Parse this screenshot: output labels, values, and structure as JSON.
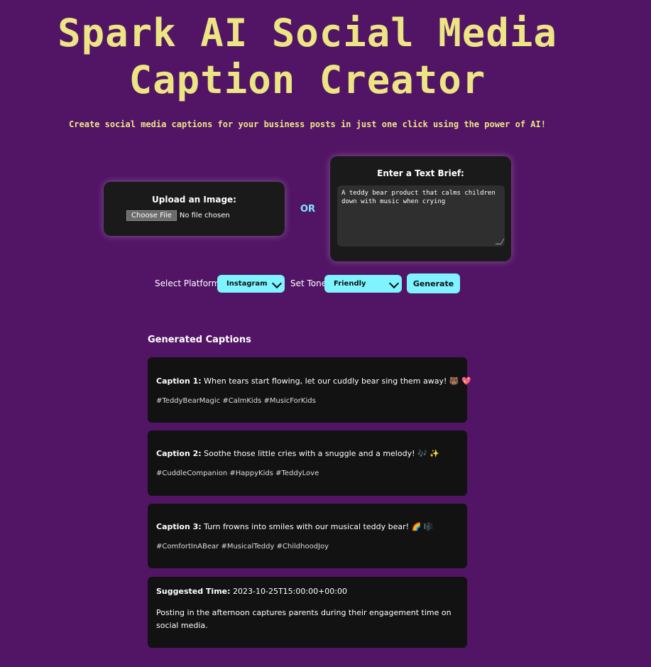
{
  "header": {
    "title_line1": "Spark AI Social Media",
    "title_line2": "Caption Creator",
    "subtitle": "Create social media captions for your business posts in just one click using the power of AI!"
  },
  "upload": {
    "label": "Upload an Image:",
    "button_label": "Choose File",
    "status": "No file chosen"
  },
  "separator": "OR",
  "brief": {
    "label": "Enter a Text Brief:",
    "value": "A teddy bear product that calms children down with music when crying"
  },
  "controls": {
    "platform_label": "Select Platform:",
    "platform_value": "Instagram",
    "tone_label": "Set Tone:",
    "tone_value": "Friendly",
    "generate_label": "Generate"
  },
  "results": {
    "heading": "Generated Captions",
    "captions": [
      {
        "label": "Caption 1:",
        "text": "When tears start flowing, let our cuddly bear sing them away! 🐻 💖",
        "tags": "#TeddyBearMagic #CalmKids #MusicForKids"
      },
      {
        "label": "Caption 2:",
        "text": "Soothe those little cries with a snuggle and a melody! 🎶 ✨",
        "tags": "#CuddleCompanion #HappyKids #TeddyLove"
      },
      {
        "label": "Caption 3:",
        "text": "Turn frowns into smiles with our musical teddy bear! 🌈 🎼",
        "tags": "#ComfortInABear #MusicalTeddy #ChildhoodJoy"
      }
    ],
    "suggested_time": {
      "label": "Suggested Time:",
      "value": "2023-10-25T15:00:00+00:00",
      "description": "Posting in the afternoon captures parents during their engagement time on social media."
    }
  },
  "colors": {
    "background": "#521565",
    "title": "#ece584",
    "accent": "#7ff3ff",
    "card": "#1a1a1a"
  }
}
